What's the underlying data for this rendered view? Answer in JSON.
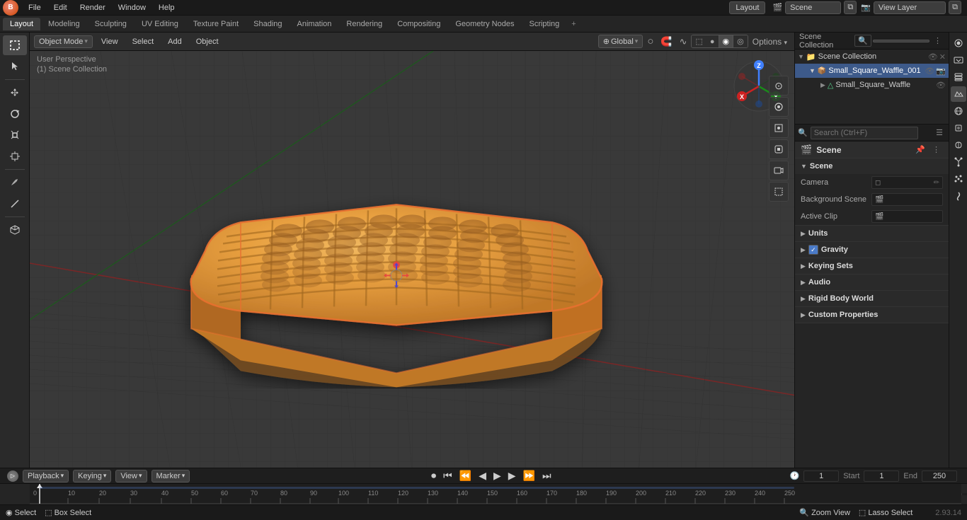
{
  "app": {
    "title": "Blender",
    "version": "2.93.14"
  },
  "top_menu": {
    "logo": "🟠",
    "items": [
      "File",
      "Edit",
      "Render",
      "Window",
      "Help"
    ]
  },
  "workspace_tabs": {
    "tabs": [
      "Layout",
      "Modeling",
      "Sculpting",
      "UV Editing",
      "Texture Paint",
      "Shading",
      "Animation",
      "Rendering",
      "Compositing",
      "Geometry Nodes",
      "Scripting"
    ],
    "active": "Layout",
    "add_label": "+"
  },
  "viewport": {
    "mode": "Object Mode",
    "view_menu": "View",
    "select_menu": "Select",
    "add_menu": "Add",
    "object_menu": "Object",
    "perspective": "User Perspective",
    "scene_collection": "(1) Scene Collection",
    "shading_solid": "●",
    "transform": "Global",
    "proportional": "○",
    "snap": "🧲",
    "gizmo_label": "⊙"
  },
  "viewport_right_tools": {
    "buttons": [
      "⊙",
      "✋",
      "🎥",
      "⬛"
    ]
  },
  "gizmo": {
    "x_label": "X",
    "y_label": "Y",
    "z_label": "Z"
  },
  "outliner": {
    "title": "Scene Collection",
    "search_placeholder": "🔍",
    "items": [
      {
        "name": "Scene Collection",
        "indent": 0,
        "expanded": true,
        "icon": "📁",
        "type": "collection"
      },
      {
        "name": "Small_Square_Waffle_001",
        "indent": 1,
        "expanded": true,
        "icon": "📦",
        "type": "object",
        "selected": true
      },
      {
        "name": "Small_Square_Waffle",
        "indent": 2,
        "expanded": false,
        "icon": "△",
        "type": "mesh"
      }
    ]
  },
  "properties": {
    "search_placeholder": "Search (Ctrl+F)",
    "header": {
      "title": "Scene",
      "icon": "🎬"
    },
    "scene_section": {
      "title": "Scene",
      "expanded": true,
      "camera_label": "Camera",
      "camera_value": "",
      "background_scene_label": "Background Scene",
      "background_scene_value": "",
      "active_clip_label": "Active Clip",
      "active_clip_value": ""
    },
    "sections": [
      {
        "label": "Units",
        "expanded": false
      },
      {
        "label": "Gravity",
        "expanded": false,
        "has_checkbox": true,
        "checkbox_checked": true
      },
      {
        "label": "Keying Sets",
        "expanded": false
      },
      {
        "label": "Audio",
        "expanded": false
      },
      {
        "label": "Rigid Body World",
        "expanded": false
      },
      {
        "label": "Custom Properties",
        "expanded": false
      }
    ]
  },
  "prop_icons": {
    "icons": [
      "🎬",
      "🌐",
      "🔧",
      "💡",
      "🌍",
      "📷",
      "🎨",
      "🔩",
      "⚙",
      "🧩"
    ]
  },
  "timeline": {
    "playback_label": "Playback",
    "keying_label": "Keying",
    "view_label": "View",
    "marker_label": "Marker",
    "record_icon": "⏺",
    "start_icon": "⏮",
    "prev_key_icon": "⏪",
    "prev_frame_icon": "◀",
    "play_icon": "▶",
    "next_frame_icon": "▶",
    "next_key_icon": "⏩",
    "end_icon": "⏭",
    "current_frame": "1",
    "start_frame": "1",
    "end_frame": "250",
    "start_label": "Start",
    "end_label": "End",
    "clock_icon": "🕐"
  },
  "timeline_numbers": [
    0,
    10,
    20,
    30,
    40,
    50,
    60,
    70,
    80,
    90,
    100,
    110,
    120,
    130,
    140,
    150,
    160,
    170,
    180,
    190,
    200,
    210,
    220,
    230,
    240,
    250
  ],
  "status_bar": {
    "select_label": "Select",
    "select_icon": "◉",
    "box_select_label": "Box Select",
    "box_select_icon": "⬚",
    "zoom_label": "Zoom View",
    "zoom_icon": "🔍",
    "lasso_label": "Lasso Select",
    "lasso_icon": "⬚",
    "version": "2.93.14"
  },
  "colors": {
    "accent_blue": "#4a7ac7",
    "accent_orange": "#e8a050",
    "selection_orange": "#e87030",
    "active_tab_bg": "#3d3d3d",
    "grid_bg": "#393939",
    "grid_line": "#2a2a2a",
    "panel_bg": "#252525"
  }
}
